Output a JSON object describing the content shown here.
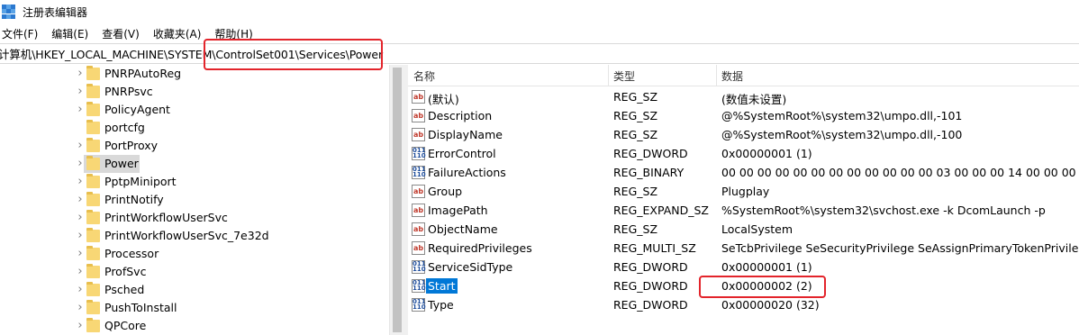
{
  "window": {
    "title": "注册表编辑器"
  },
  "menu": [
    "文件(F)",
    "编辑(E)",
    "查看(V)",
    "收藏夹(A)",
    "帮助(H)"
  ],
  "address": "计算机\\HKEY_LOCAL_MACHINE\\SYSTEM\\ControlSet001\\Services\\Power",
  "tree": {
    "items": [
      {
        "label": "PNRPAutoReg",
        "expandable": true
      },
      {
        "label": "PNRPsvc",
        "expandable": true
      },
      {
        "label": "PolicyAgent",
        "expandable": true
      },
      {
        "label": "portcfg",
        "expandable": false
      },
      {
        "label": "PortProxy",
        "expandable": true
      },
      {
        "label": "Power",
        "expandable": true,
        "selected": true
      },
      {
        "label": "PptpMiniport",
        "expandable": true
      },
      {
        "label": "PrintNotify",
        "expandable": true
      },
      {
        "label": "PrintWorkflowUserSvc",
        "expandable": true
      },
      {
        "label": "PrintWorkflowUserSvc_7e32d",
        "expandable": true
      },
      {
        "label": "Processor",
        "expandable": true
      },
      {
        "label": "ProfSvc",
        "expandable": true
      },
      {
        "label": "Psched",
        "expandable": true
      },
      {
        "label": "PushToInstall",
        "expandable": true
      },
      {
        "label": "QPCore",
        "expandable": true
      }
    ]
  },
  "list": {
    "headers": {
      "name": "名称",
      "type": "类型",
      "data": "数据"
    },
    "rows": [
      {
        "icon": "string-value-icon",
        "name": "(默认)",
        "type": "REG_SZ",
        "data": "(数值未设置)"
      },
      {
        "icon": "string-value-icon",
        "name": "Description",
        "type": "REG_SZ",
        "data": "@%SystemRoot%\\system32\\umpo.dll,-101"
      },
      {
        "icon": "string-value-icon",
        "name": "DisplayName",
        "type": "REG_SZ",
        "data": "@%SystemRoot%\\system32\\umpo.dll,-100"
      },
      {
        "icon": "binary-value-icon",
        "name": "ErrorControl",
        "type": "REG_DWORD",
        "data": "0x00000001 (1)"
      },
      {
        "icon": "binary-value-icon",
        "name": "FailureActions",
        "type": "REG_BINARY",
        "data": "00 00 00 00 00 00 00 00 00 00 00 00 03 00 00 00 14 00 00 00 02 00 0"
      },
      {
        "icon": "string-value-icon",
        "name": "Group",
        "type": "REG_SZ",
        "data": "Plugplay"
      },
      {
        "icon": "string-value-icon",
        "name": "ImagePath",
        "type": "REG_EXPAND_SZ",
        "data": "%SystemRoot%\\system32\\svchost.exe -k DcomLaunch -p"
      },
      {
        "icon": "string-value-icon",
        "name": "ObjectName",
        "type": "REG_SZ",
        "data": "LocalSystem"
      },
      {
        "icon": "string-value-icon",
        "name": "RequiredPrivileges",
        "type": "REG_MULTI_SZ",
        "data": "SeTcbPrivilege SeSecurityPrivilege SeAssignPrimaryTokenPrivilege Se"
      },
      {
        "icon": "binary-value-icon",
        "name": "ServiceSidType",
        "type": "REG_DWORD",
        "data": "0x00000001 (1)"
      },
      {
        "icon": "binary-value-icon",
        "name": "Start",
        "type": "REG_DWORD",
        "data": "0x00000002 (2)",
        "selected": true
      },
      {
        "icon": "binary-value-icon",
        "name": "Type",
        "type": "REG_DWORD",
        "data": "0x00000020 (32)"
      }
    ]
  },
  "colors": {
    "highlight_box": "#e3242b",
    "selection": "#0078d7",
    "tree_selection": "#d9d9d9",
    "folder": "#f8d775"
  }
}
